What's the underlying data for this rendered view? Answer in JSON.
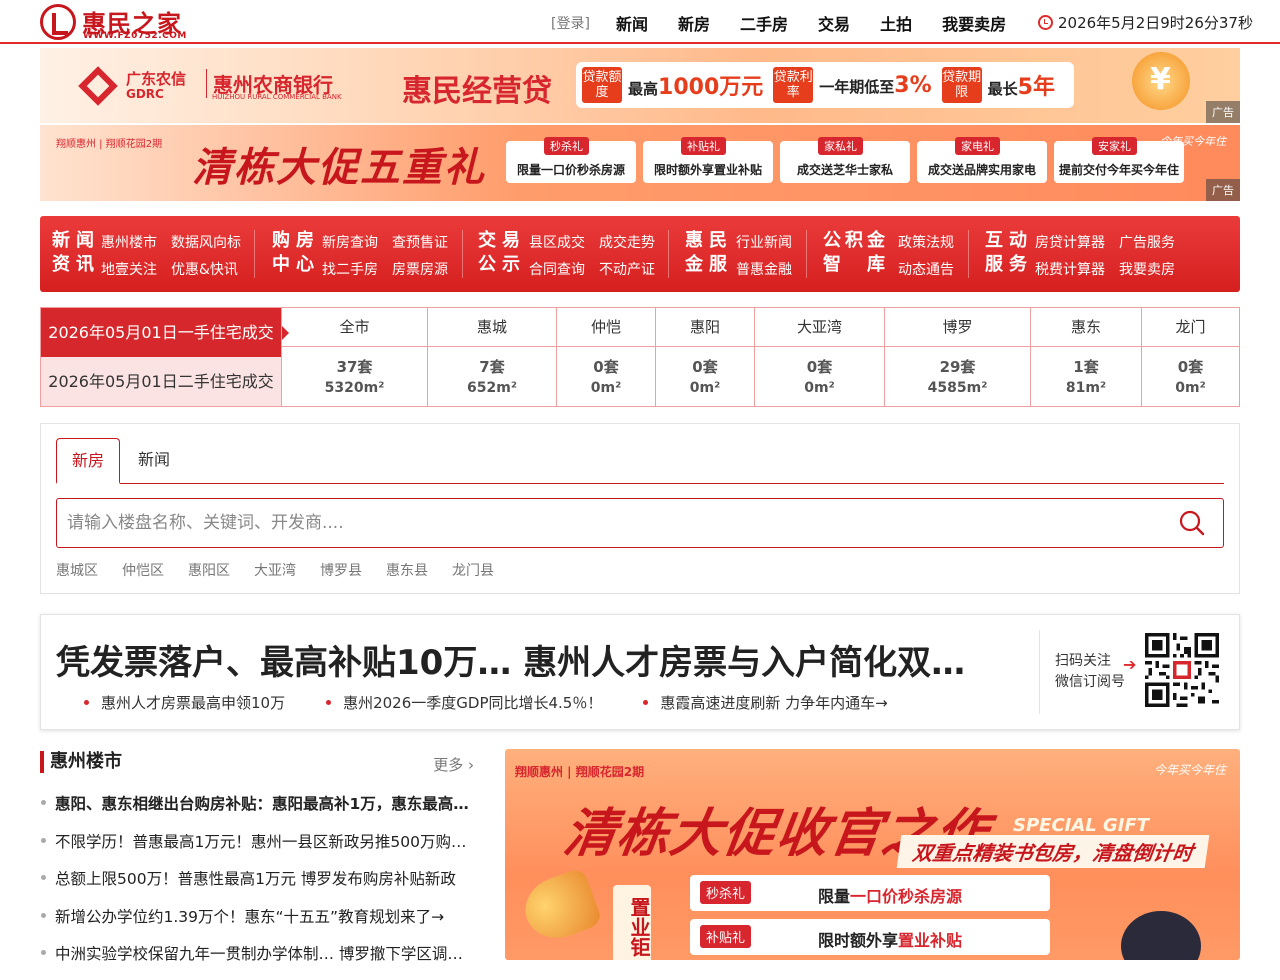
{
  "header": {
    "logo_name": "惠民之家",
    "logo_url": "WWW.FZ0752.COM",
    "login": "[登录]",
    "nav": [
      "新闻",
      "新房",
      "二手房",
      "交易",
      "土拍",
      "我要卖房"
    ],
    "datetime": "2026年5月2日9时26分37秒"
  },
  "banner1": {
    "bank_line1": "广东农信",
    "bank_line1b": "GDRC",
    "bank_name": "惠州农商银行",
    "bank_name_en": "HUIZHOU RURAL COMMERCIAL BANK",
    "title": "惠民经营贷",
    "items": [
      {
        "chip": "贷款额度",
        "text_pre": "最高",
        "value": "1000万元"
      },
      {
        "chip": "贷款利率",
        "text_pre": "一年期低至",
        "value": "3%"
      },
      {
        "chip": "贷款期限",
        "text_pre": "最长",
        "value": "5年"
      }
    ],
    "ad_tag": "广告"
  },
  "banner2": {
    "logo": "翔顺惠州 | 翔顺花园2期",
    "title": "清栋大促五重礼",
    "cards": [
      {
        "tag": "秒杀礼",
        "text": "限量一口价秒杀房源"
      },
      {
        "tag": "补贴礼",
        "text": "限时额外享置业补贴"
      },
      {
        "tag": "家私礼",
        "text": "成交送芝华士家私"
      },
      {
        "tag": "家电礼",
        "text": "成交送品牌实用家电"
      },
      {
        "tag": "安家礼",
        "text": "提前交付今年买今年住"
      }
    ],
    "corner": "今年买今年住",
    "ad_tag": "广告"
  },
  "quicknav": {
    "groups": [
      {
        "head1": "新闻",
        "head2": "资讯",
        "links": [
          "惠州楼市",
          "数据风向标",
          "地壹关注",
          "优惠&快讯"
        ]
      },
      {
        "head1": "购房",
        "head2": "中心",
        "links": [
          "新房查询",
          "查预售证",
          "找二手房",
          "房票房源"
        ]
      },
      {
        "head1": "交易",
        "head2": "公示",
        "links": [
          "县区成交",
          "成交走势",
          "合同查询",
          "不动产证"
        ]
      },
      {
        "head1": "惠民",
        "head2": "金服",
        "links": [
          "行业新闻",
          "普惠金融"
        ]
      },
      {
        "head1": "公积金",
        "head2": "智　库",
        "links": [
          "政策法规",
          "动态通告"
        ]
      },
      {
        "head1": "互动",
        "head2": "服务",
        "links": [
          "房贷计算器",
          "广告服务",
          "税费计算器",
          "我要卖房"
        ]
      }
    ]
  },
  "trade": {
    "label_new": "2026年05月01日一手住宅成交",
    "label_second": "2026年05月01日二手住宅成交",
    "columns": [
      {
        "name": "全市",
        "units": "37套",
        "area": "5320m²"
      },
      {
        "name": "惠城",
        "units": "7套",
        "area": "652m²"
      },
      {
        "name": "仲恺",
        "units": "0套",
        "area": "0m²"
      },
      {
        "name": "惠阳",
        "units": "0套",
        "area": "0m²"
      },
      {
        "name": "大亚湾",
        "units": "0套",
        "area": "0m²"
      },
      {
        "name": "博罗",
        "units": "29套",
        "area": "4585m²"
      },
      {
        "name": "惠东",
        "units": "1套",
        "area": "81m²"
      },
      {
        "name": "龙门",
        "units": "0套",
        "area": "0m²"
      }
    ]
  },
  "search": {
    "tabs": [
      "新房",
      "新闻"
    ],
    "placeholder": "请输入楼盘名称、关键词、开发商....",
    "districts": [
      "惠城区",
      "仲恺区",
      "惠阳区",
      "大亚湾",
      "博罗县",
      "惠东县",
      "龙门县"
    ]
  },
  "headline": {
    "title": "凭发票落户、最高补贴10万… 惠州人才房票与入户简化双…",
    "subs": [
      "惠州人才房票最高申领10万",
      "惠州2026一季度GDP同比增长4.5％！",
      "惠霞高速进度刷新 力争年内通车→"
    ],
    "qr_text1": "扫码关注",
    "qr_text2": "微信订阅号"
  },
  "news": {
    "title": "惠州楼市",
    "more": "更多",
    "items": [
      "惠阳、惠东相继出台购房补贴：惠阳最高补1万，惠东最高…",
      "不限学历！普惠最高1万元！惠州一县区新政另推500万购…",
      "总额上限500万！普惠性最高1万元 博罗发布购房补贴新政",
      "新增公办学位约1.39万个！惠东“十五五”教育规划来了→",
      "中洲实验学校保留九年一贯制办学体制… 博罗撤下学区调…"
    ]
  },
  "bigad": {
    "logo": "翔顺惠州 | 翔顺花园2期",
    "corner": "今年买今年住",
    "title": "清栋大促收官之作",
    "special": "SPECIAL GIFT",
    "sub": "双重点精装书包房，清盘倒计时",
    "side": "置业钜",
    "cards": [
      {
        "tag": "秒杀礼",
        "pre": "限量",
        "hl": "一口价秒杀房源"
      },
      {
        "tag": "补贴礼",
        "pre": "限时额外享",
        "hl": "置业补贴"
      }
    ]
  }
}
